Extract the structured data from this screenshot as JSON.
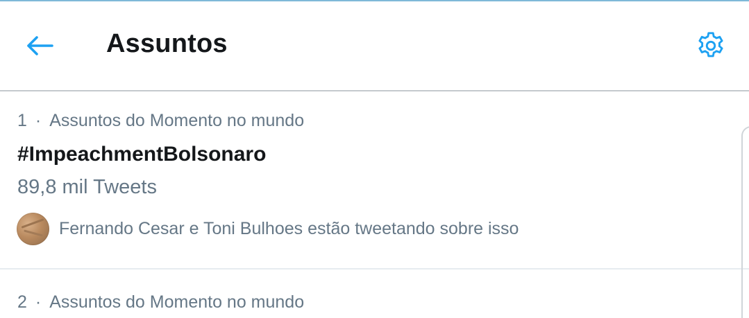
{
  "header": {
    "back_icon": "arrow-left-icon",
    "title": "Assuntos",
    "settings_icon": "gear-icon",
    "accent_color": "#1da1f2"
  },
  "trends": [
    {
      "rank": "1",
      "separator": "·",
      "context": "Assuntos do Momento no mundo",
      "name": "#ImpeachmentBolsonaro",
      "count": "89,8 mil Tweets",
      "social_context": "Fernando Cesar e Toni Bulhoes estão tweetando sobre isso"
    },
    {
      "rank": "2",
      "separator": "·",
      "context": "Assuntos do Momento no mundo"
    }
  ]
}
